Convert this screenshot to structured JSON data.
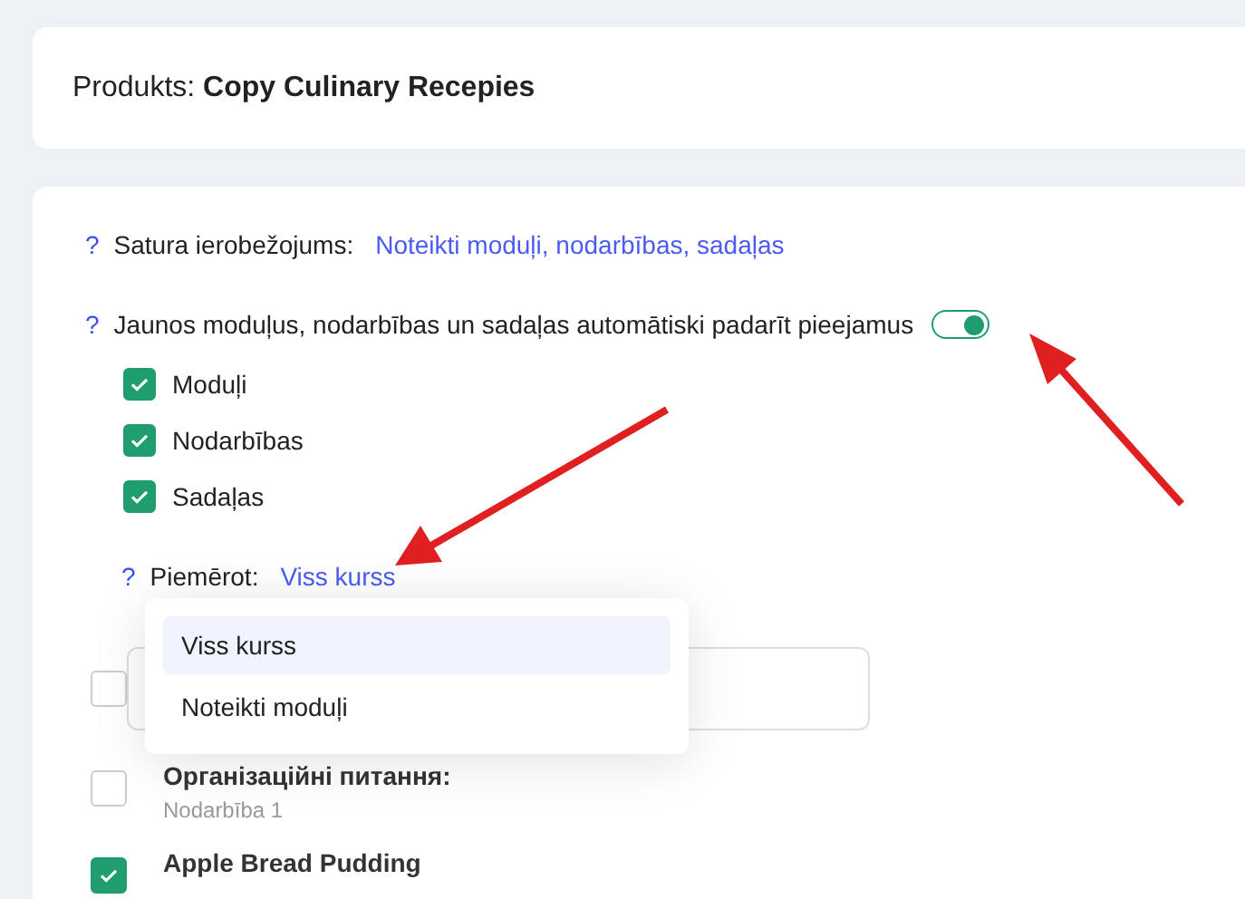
{
  "product": {
    "label": "Produkts:",
    "name": "Copy Culinary Recepies"
  },
  "restriction": {
    "help": "?",
    "label": "Satura ierobežojums:",
    "value": "Noteikti moduļi, nodarbības, sadaļas"
  },
  "auto_available": {
    "help": "?",
    "label": "Jaunos moduļus, nodarbības un sadaļas automātiski padarīt pieejamus",
    "on": true
  },
  "options": [
    {
      "label": "Moduļi",
      "checked": true
    },
    {
      "label": "Nodarbības",
      "checked": true
    },
    {
      "label": "Sadaļas",
      "checked": true
    }
  ],
  "apply": {
    "help": "?",
    "label": "Piemērot:",
    "value": "Viss kurss",
    "expanded": true,
    "menu": [
      {
        "label": "Viss kurss",
        "selected": true
      },
      {
        "label": "Noteikti moduļi",
        "selected": false
      }
    ]
  },
  "lessons": [
    {
      "kind": "field",
      "checked": false
    },
    {
      "kind": "item",
      "title": "Організаційні питання:",
      "subtitle": "Nodarbība 1",
      "checked": false
    },
    {
      "kind": "item",
      "title": "Apple Bread Pudding",
      "checked": true
    }
  ]
}
